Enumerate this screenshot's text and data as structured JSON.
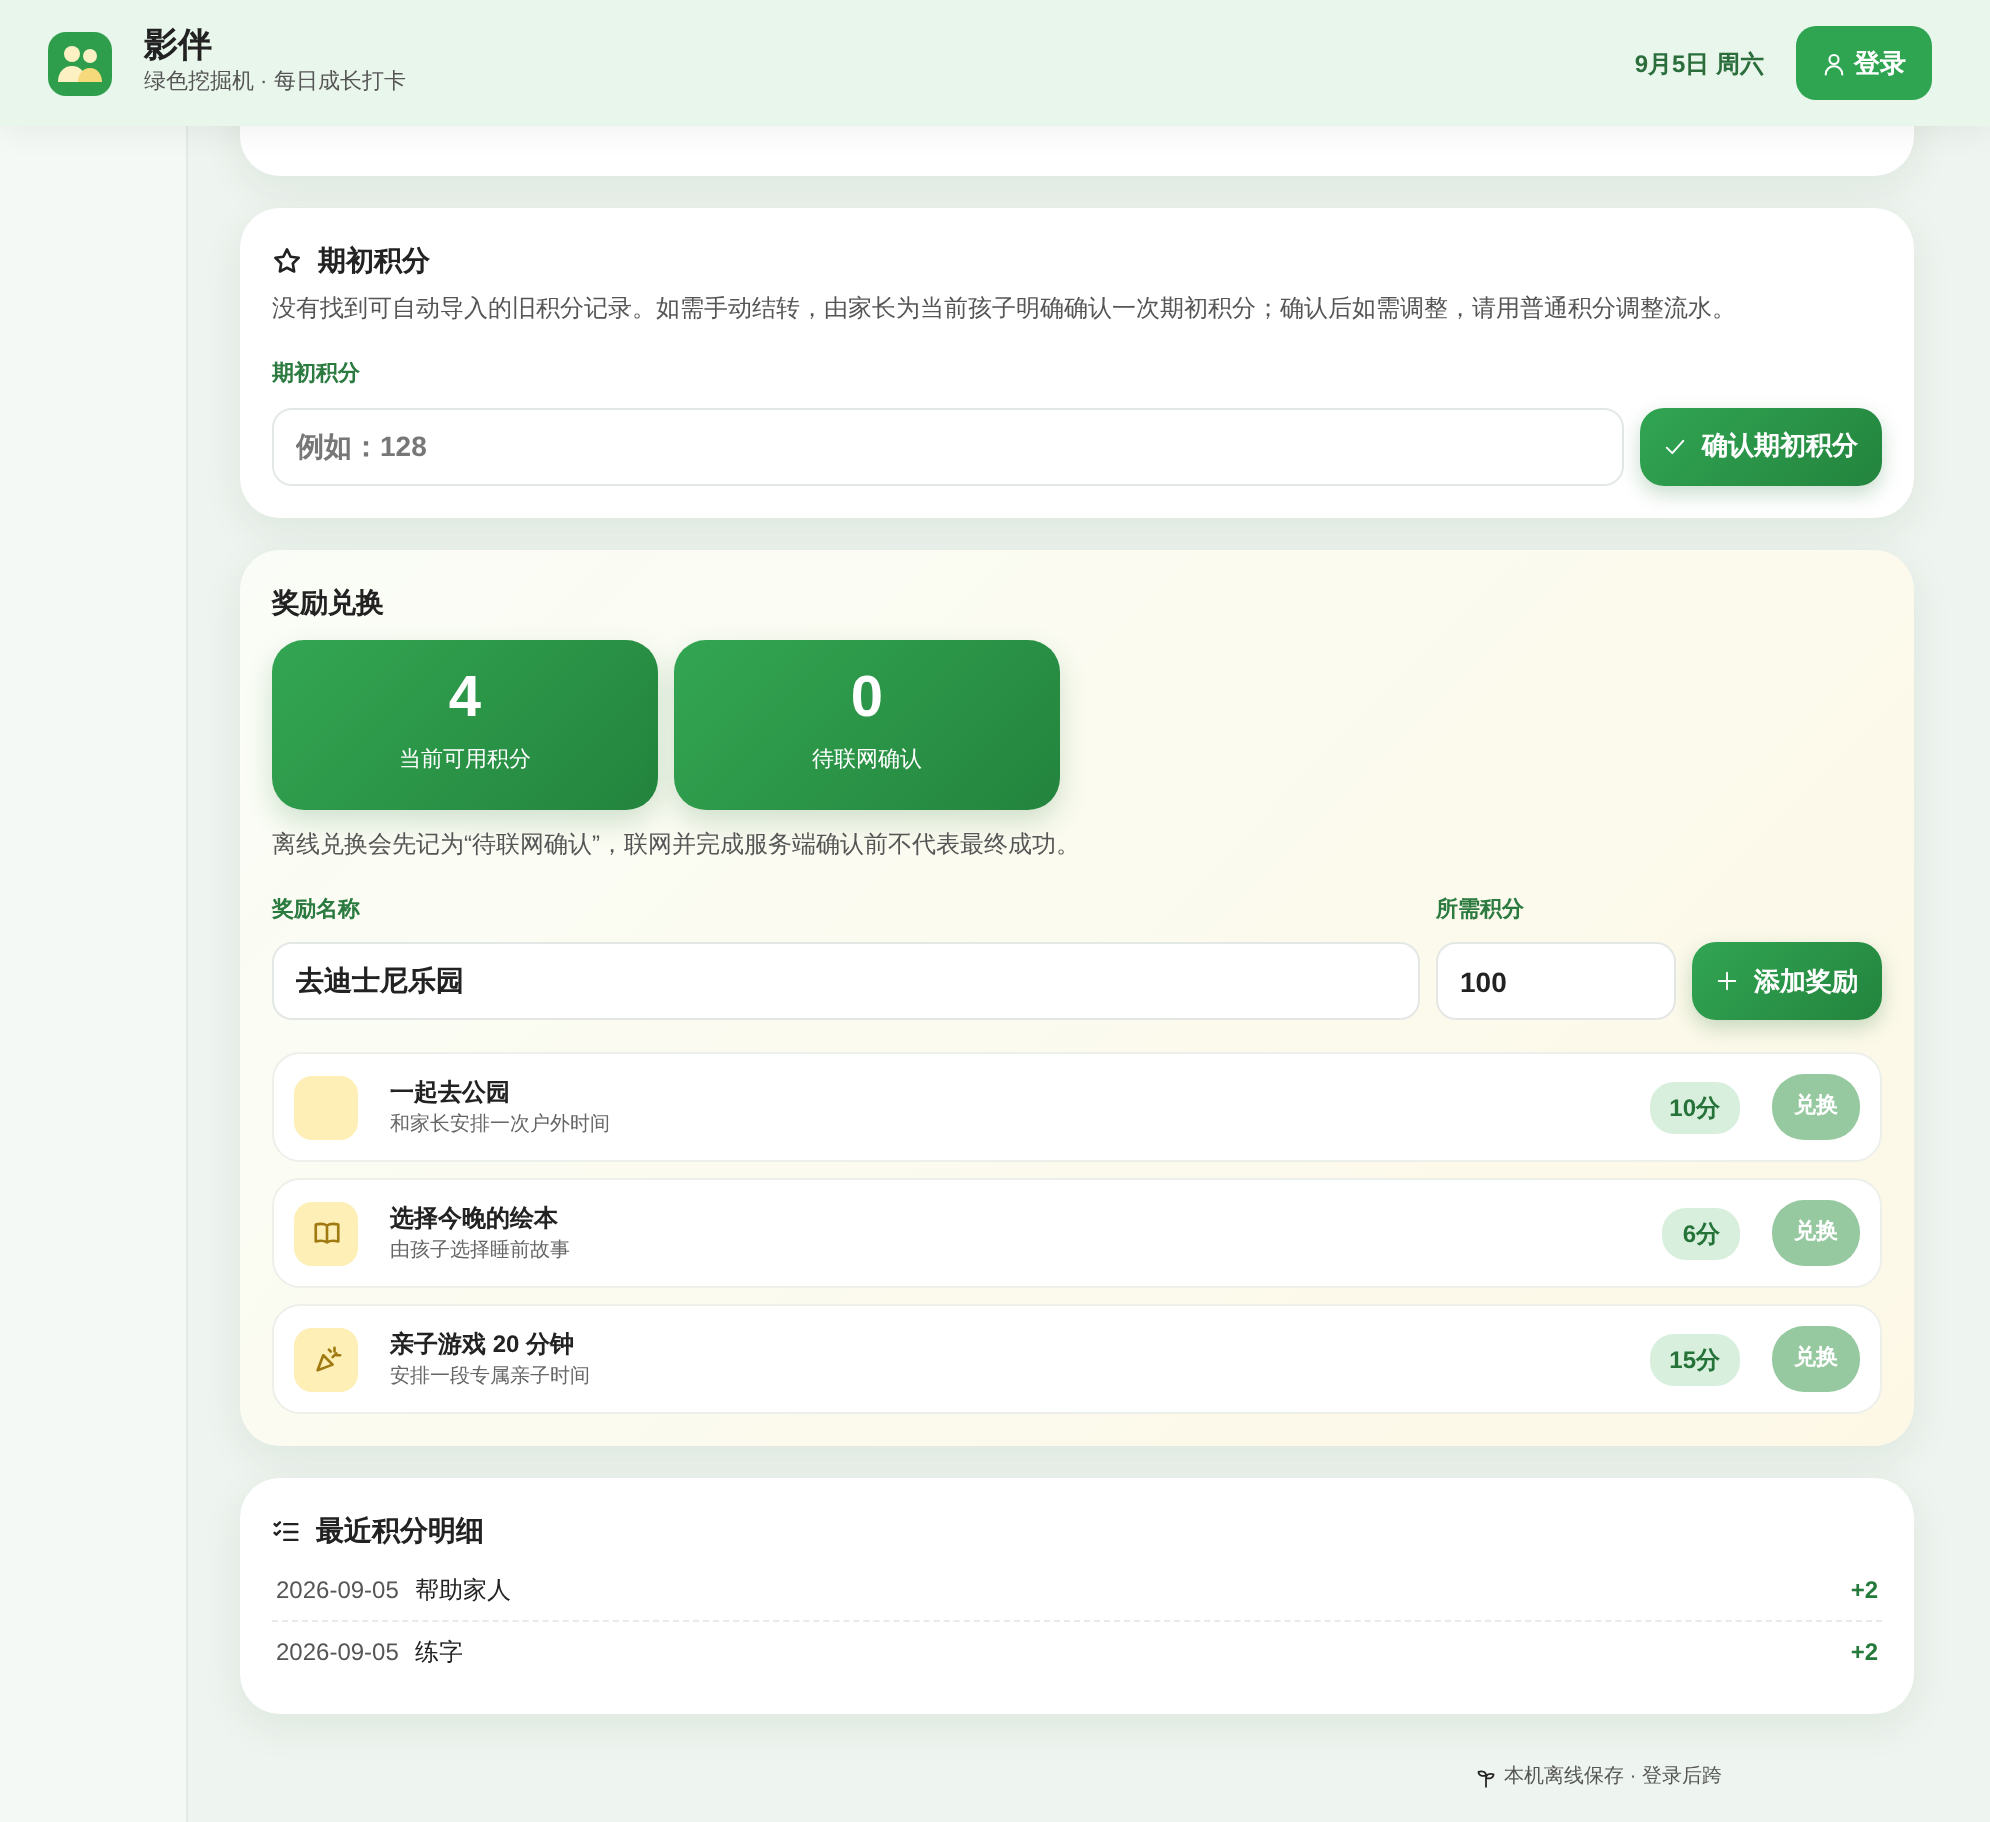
{
  "header": {
    "app_name": "影伴",
    "subtitle": "绿色挖掘机 · 每日成长打卡",
    "date": "9月5日 周六",
    "login_button": "登录"
  },
  "opening_points": {
    "title": "期初积分",
    "description": "没有找到可自动导入的旧积分记录。如需手动结转，由家长为当前孩子明确确认一次期初积分；确认后如需调整，请用普通积分调整流水。",
    "field_label": "期初积分",
    "placeholder": "例如：128",
    "button": "确认期初积分"
  },
  "rewards": {
    "title": "奖励兑换",
    "stats": [
      {
        "value": "4",
        "label": "当前可用积分"
      },
      {
        "value": "0",
        "label": "待联网确认"
      }
    ],
    "note": "离线兑换会先记为“待联网确认”，联网并完成服务端确认前不代表最终成功。",
    "name_label": "奖励名称",
    "name_value": "去迪士尼乐园",
    "cost_label": "所需积分",
    "cost_value": "100",
    "add_button": "添加奖励",
    "items": [
      {
        "kind": "blank",
        "title": "一起去公园",
        "subtitle": "和家长安排一次户外时间",
        "cost": "10分",
        "button": "兑换",
        "disabled": true
      },
      {
        "kind": "book",
        "title": "选择今晚的绘本",
        "subtitle": "由孩子选择睡前故事",
        "cost": "6分",
        "button": "兑换",
        "disabled": true
      },
      {
        "kind": "party",
        "title": "亲子游戏 20 分钟",
        "subtitle": "安排一段专属亲子时间",
        "cost": "15分",
        "button": "兑换",
        "disabled": true
      }
    ]
  },
  "recent": {
    "title": "最近积分明细",
    "rows": [
      {
        "date": "2026-09-05",
        "description": "帮助家人",
        "delta": "+2"
      },
      {
        "date": "2026-09-05",
        "description": "练字",
        "delta": "+2"
      }
    ]
  },
  "footer": "本机离线保存 · 登录后跨"
}
